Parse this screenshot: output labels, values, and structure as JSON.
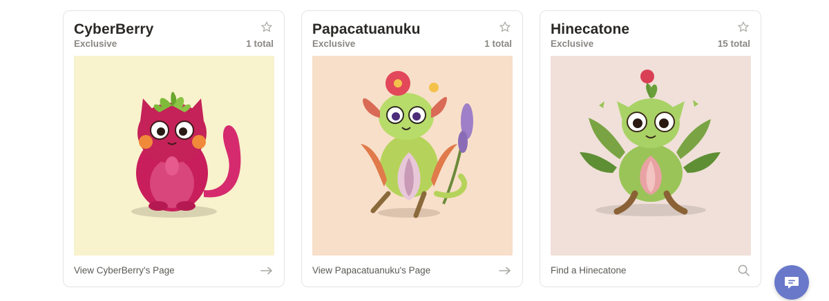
{
  "cards": [
    {
      "name": "CyberBerry",
      "tag": "Exclusive",
      "total": "1 total",
      "link": "View CyberBerry's Page",
      "action_icon": "arrow-right-icon",
      "bg_color": "#f8f2cd"
    },
    {
      "name": "Papacatuanuku",
      "tag": "Exclusive",
      "total": "1 total",
      "link": "View Papacatuanuku's Page",
      "action_icon": "arrow-right-icon",
      "bg_color": "#f8dfc9"
    },
    {
      "name": "Hinecatone",
      "tag": "Exclusive",
      "total": "15 total",
      "link": "Find a Hinecatone",
      "action_icon": "search-icon",
      "bg_color": "#f0e0d9"
    }
  ],
  "chat_icon": "chat-bubble-icon",
  "colors": {
    "chat_button": "#6978c9",
    "muted_text": "#8a8783",
    "title_text": "#2a2825"
  }
}
